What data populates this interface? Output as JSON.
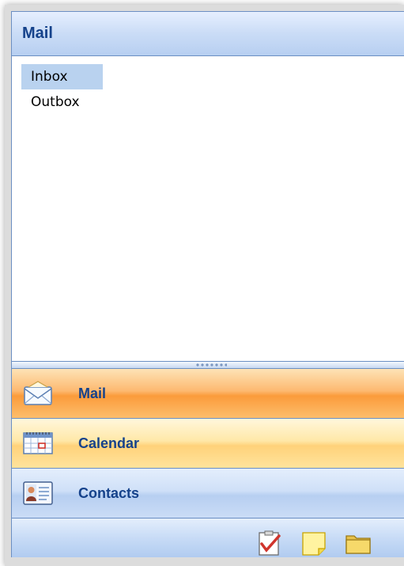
{
  "header": {
    "title": "Mail"
  },
  "folders": [
    {
      "label": "Inbox",
      "selected": true
    },
    {
      "label": "Outbox",
      "selected": false
    }
  ],
  "nav_buttons": [
    {
      "label": "Mail",
      "icon": "envelope-icon",
      "state": "active"
    },
    {
      "label": "Calendar",
      "icon": "calendar-icon",
      "state": "hover"
    },
    {
      "label": "Contacts",
      "icon": "contact-card-icon",
      "state": "normal"
    }
  ],
  "footer_tools": [
    {
      "icon": "tasks-icon"
    },
    {
      "icon": "notes-icon"
    },
    {
      "icon": "folder-icon"
    }
  ],
  "colors": {
    "header_text": "#15428b",
    "border": "#6b8fc3",
    "selected_row": "#b9d2ef",
    "active_nav": "#fb9b3b"
  }
}
